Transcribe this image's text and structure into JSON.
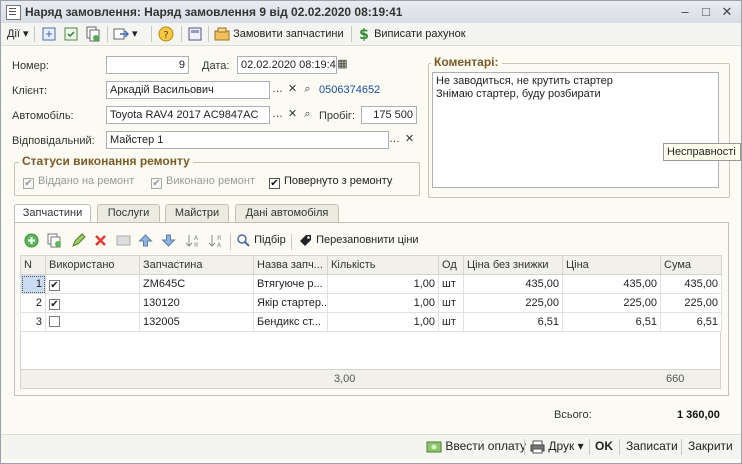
{
  "window": {
    "title": "Наряд замовлення: Наряд замовлення 9 від 02.02.2020 08:19:41"
  },
  "toolbar": {
    "actions_label": "Дії",
    "order_parts_label": "Замовити запчастини",
    "issue_invoice_label": "Виписати рахунок"
  },
  "form": {
    "number_label": "Номер:",
    "number_value": "9",
    "date_label": "Дата:",
    "date_value": "02.02.2020 08:19:4",
    "client_label": "Клієнт:",
    "client_value": "Аркадій Васильович",
    "client_phone": "0506374652",
    "car_label": "Автомобіль:",
    "car_value": "Toyota RAV4 2017 AC9847AC",
    "mileage_label": "Пробіг:",
    "mileage_value": "175 500",
    "responsible_label": "Відповідальний:",
    "responsible_value": "Майстер 1"
  },
  "comment": {
    "title": "Коментарі:",
    "line1": "Не заводиться, не крутить стартер",
    "line2": "Знімаю стартер, буду розбирати",
    "tooltip": "Несправності"
  },
  "statuses": {
    "title": "Статуси виконання ремонту",
    "given_label": "Віддано на ремонт",
    "done_label": "Виконано ремонт",
    "returned_label": "Повернуто з ремонту"
  },
  "tabs": [
    "Запчастини",
    "Послуги",
    "Майстри",
    "Дані автомобіля"
  ],
  "grid_toolbar": {
    "pick_label": "Підбір",
    "refill_label": "Перезаповнити ціни"
  },
  "grid": {
    "columns": [
      "N",
      "Використано",
      "Запчастина",
      "Назва запч...",
      "Кількість",
      "Од",
      "Ціна без знижки",
      "Ціна",
      "Сума"
    ],
    "rows": [
      {
        "n": "1",
        "used": "✔",
        "part": "ZM645C",
        "name": "Втягуюче р...",
        "qty": "1,00",
        "unit": "шт",
        "price_nd": "435,00",
        "price": "435,00",
        "sum": "435,00"
      },
      {
        "n": "2",
        "used": "✔",
        "part": "130120",
        "name": "Якір стартер...",
        "qty": "1,00",
        "unit": "шт",
        "price_nd": "225,00",
        "price": "225,00",
        "sum": "225,00"
      },
      {
        "n": "3",
        "used": "",
        "part": "132005",
        "name": "Бендикс ст...",
        "qty": "1,00",
        "unit": "шт",
        "price_nd": "6,51",
        "price": "6,51",
        "sum": "6,51"
      }
    ],
    "total_qty": "3,00",
    "total_sum": "660"
  },
  "total": {
    "label": "Всього:",
    "value": "1 360,00"
  },
  "bottom": {
    "pay_label": "Ввести оплату",
    "print_label": "Друк",
    "ok_label": "OK",
    "save_label": "Записати",
    "close_label": "Закрити"
  }
}
